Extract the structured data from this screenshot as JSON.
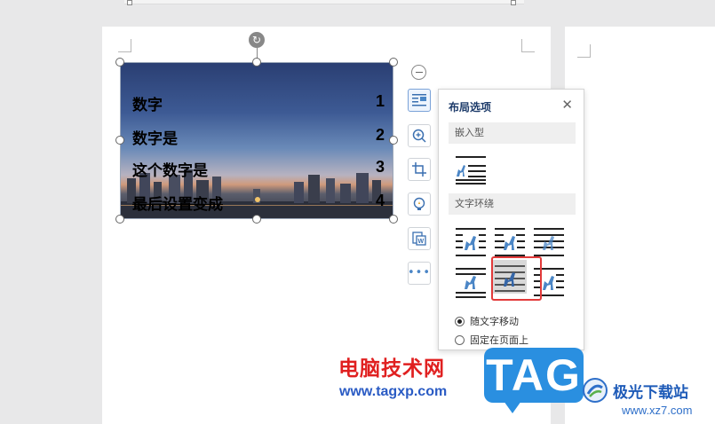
{
  "image_text": {
    "lines": [
      {
        "text": "数字",
        "num": "1"
      },
      {
        "text": "数字是",
        "num": "2"
      },
      {
        "text": "这个数字是",
        "num": "3"
      },
      {
        "text": "最后设置变成",
        "num": "4"
      }
    ]
  },
  "toolbar": {
    "items": [
      "zoom-out",
      "layout-options",
      "zoom-in",
      "crop",
      "idea",
      "convert-to-doc",
      "more"
    ]
  },
  "layout_panel": {
    "title": "布局选项",
    "section_inline": "嵌入型",
    "section_wrap": "文字环绕",
    "radio_move_with_text": "随文字移动",
    "radio_fixed_on_page": "固定在页面上"
  },
  "watermark": {
    "site_cn": "电脑技术网",
    "site_url": "www.tagxp.com",
    "badge": "TAG",
    "brand_cn": "极光下载站",
    "brand_url": "www.xz7.com"
  },
  "colors": {
    "accent": "#4b86c6",
    "highlight_red": "#e23a3a",
    "badge_blue": "#2a8fe0",
    "watermark_red": "#e02020"
  }
}
